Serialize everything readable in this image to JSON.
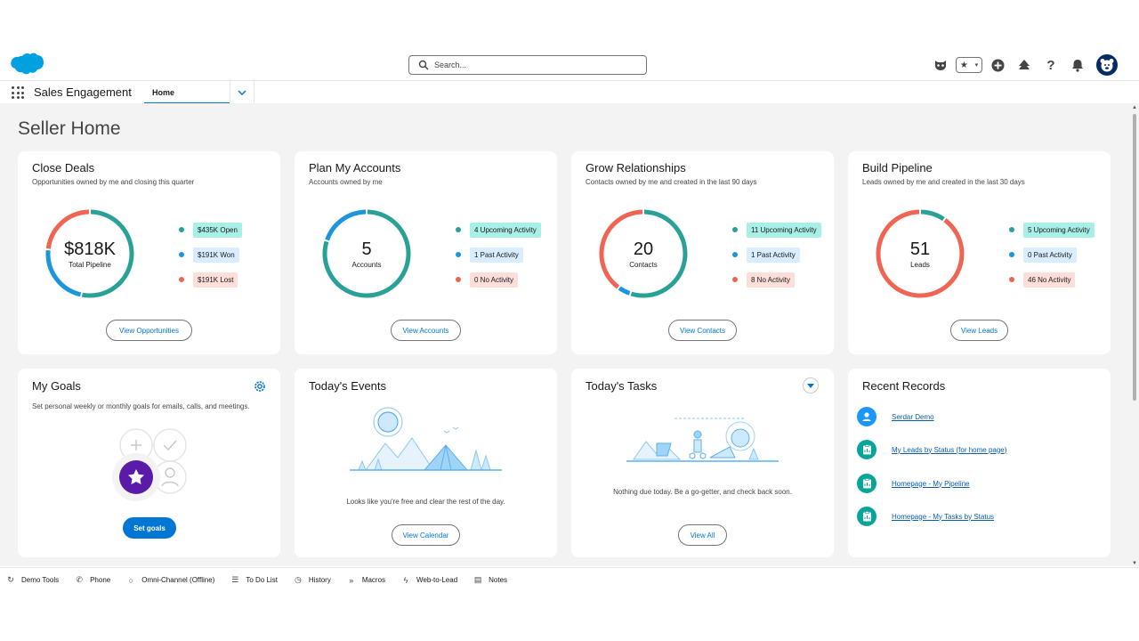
{
  "header": {
    "search_placeholder": "Search...",
    "icons": [
      "salesforce-logo",
      "einstein-icon",
      "star-icon",
      "chevron-down-icon",
      "add-icon",
      "trailhead-icon",
      "help-icon",
      "bell-icon",
      "avatar"
    ]
  },
  "nav": {
    "app_name": "Sales Engagement",
    "tab_home": "Home"
  },
  "page_title": "Seller Home",
  "cards": {
    "close_deals": {
      "title": "Close Deals",
      "subtitle": "Opportunities owned by me and closing this quarter",
      "center_value": "$818K",
      "center_label": "Total Pipeline",
      "legend": [
        "$435K Open",
        "$191K Won",
        "$191K Lost"
      ],
      "button": "View Opportunities",
      "segments": [
        435,
        191,
        191
      ]
    },
    "plan_accounts": {
      "title": "Plan My Accounts",
      "subtitle": "Accounts owned by me",
      "center_value": "5",
      "center_label": "Accounts",
      "legend": [
        "4 Upcoming Activity",
        "1 Past Activity",
        "0 No Activity"
      ],
      "button": "View Accounts",
      "segments": [
        4,
        1,
        0
      ]
    },
    "grow_relationships": {
      "title": "Grow Relationships",
      "subtitle": "Contacts owned by me and created in the last 90 days",
      "center_value": "20",
      "center_label": "Contacts",
      "legend": [
        "11 Upcoming Activity",
        "1 Past Activity",
        "8 No Activity"
      ],
      "button": "View Contacts",
      "segments": [
        11,
        1,
        8
      ]
    },
    "build_pipeline": {
      "title": "Build Pipeline",
      "subtitle": "Leads owned by me and created in the last 30 days",
      "center_value": "51",
      "center_label": "Leads",
      "legend": [
        "5 Upcoming Activity",
        "0 Past Activity",
        "46 No Activity"
      ],
      "button": "View Leads",
      "segments": [
        5,
        0,
        46
      ]
    },
    "my_goals": {
      "title": "My Goals",
      "subtitle": "Set personal weekly or monthly goals for emails, calls, and meetings.",
      "button": "Set goals"
    },
    "todays_events": {
      "title": "Today's Events",
      "message": "Looks like you're free and clear the rest of the day.",
      "button": "View Calendar"
    },
    "todays_tasks": {
      "title": "Today's Tasks",
      "message": "Nothing due today. Be a go-getter, and check back soon.",
      "button": "View All"
    },
    "recent_records": {
      "title": "Recent Records",
      "items": [
        "Serdar Demo",
        "My Leads by Status (for home page)",
        "Homepage - My Pipeline",
        "Homepage - My Tasks by Status"
      ]
    }
  },
  "colors": {
    "open": "#2aa197",
    "won": "#1b96dc",
    "lost": "#f06453",
    "pill_open_bg": "#a8f0e6",
    "pill_won_bg": "#d8edff",
    "pill_lost_bg": "#fdded9",
    "accent": "#0176d3"
  },
  "utility": [
    "Demo Tools",
    "Phone",
    "Omni-Channel (Offline)",
    "To Do List",
    "History",
    "Macros",
    "Web-to-Lead",
    "Notes"
  ]
}
